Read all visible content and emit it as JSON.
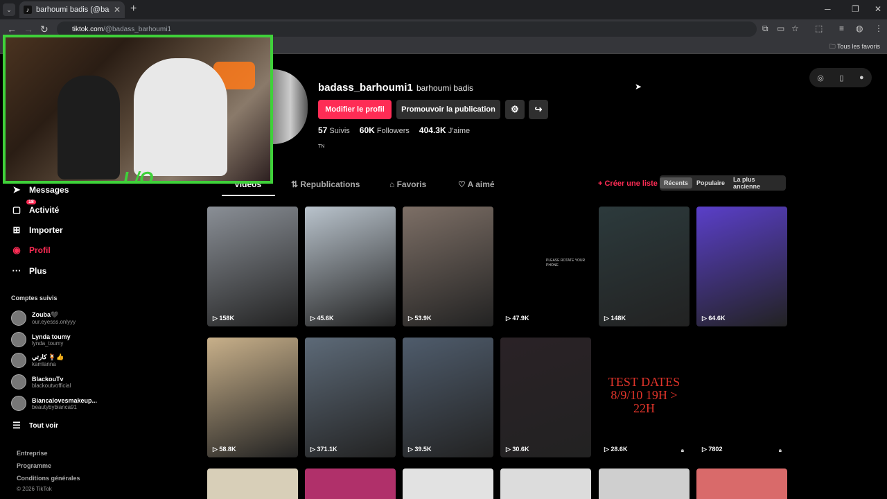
{
  "browser": {
    "tab_title": "barhoumi badis (@badass_barh",
    "url_host": "tiktok.com",
    "url_path": "/@badass_barhoumi1",
    "bookmarks_label": "Tous les favoris"
  },
  "stream_overlay": {
    "logo_text": "L/O"
  },
  "sidebar": {
    "items": [
      {
        "label": "Messages",
        "icon": "send-icon"
      },
      {
        "label": "Activité",
        "icon": "inbox-icon",
        "badge": "18"
      },
      {
        "label": "Importer",
        "icon": "upload-icon"
      },
      {
        "label": "Profil",
        "icon": "profile-avatar-icon"
      },
      {
        "label": "Plus",
        "icon": "more-dots-icon"
      }
    ],
    "following_title": "Comptes suivis",
    "following": [
      {
        "name": "Zouba🖤",
        "handle": "our.eyesss.onlyyy"
      },
      {
        "name": "Lynda toumy",
        "handle": "lynda_toumy"
      },
      {
        "name": "كارتي 🍹👍",
        "handle": "kamlanna"
      },
      {
        "name": "BlackouTv",
        "handle": "blackoutvofficial"
      },
      {
        "name": "Biancalovesmakeup...",
        "handle": "beautybybianca91"
      }
    ],
    "see_all": "Tout voir",
    "footer": [
      "Entreprise",
      "Programme",
      "Conditions générales"
    ],
    "copyright": "© 2026 TikTok"
  },
  "profile": {
    "username": "badass_barhoumi1",
    "display_name": "barhoumi badis",
    "edit_button": "Modifier le profil",
    "promote_button": "Promouvoir la publication",
    "following_count": "57",
    "following_label": "Suivis",
    "followers_count": "60K",
    "followers_label": "Followers",
    "likes_count": "404.3K",
    "likes_label": "J'aime",
    "region": "TN"
  },
  "content_tabs": {
    "videos": "Vidéos",
    "reposts": "Republications",
    "favorites": "Favoris",
    "liked": "A aimé",
    "create_list": "+ Créer une liste de lecture",
    "sort": [
      "Récents",
      "Populaire",
      "La plus ancienne"
    ]
  },
  "videos": [
    {
      "views": "158K",
      "color": "#8a8f96"
    },
    {
      "views": "45.6K",
      "color": "#b9c3cc"
    },
    {
      "views": "53.9K",
      "color": "#7d6f66"
    },
    {
      "views": "47.9K",
      "color": "#000000",
      "overlay": "PLEASE ROTATE YOUR PHONE"
    },
    {
      "views": "148K",
      "color": "#2c3a3c"
    },
    {
      "views": "64.6K",
      "color": "#5a3fc9"
    },
    {
      "views": "58.8K",
      "color": "#c8b08a"
    },
    {
      "views": "371.1K",
      "color": "#5d6a78"
    },
    {
      "views": "39.5K",
      "color": "#4f5c6c"
    },
    {
      "views": "30.6K",
      "color": "#2a2226"
    },
    {
      "views": "28.6K",
      "color": "#000000",
      "overlay": "TEST DATES 8/9/10 19H > 22H",
      "locked": true
    },
    {
      "views": "7802",
      "color": "#000000",
      "locked": true
    }
  ],
  "third_row_colors": [
    "#d8cfb8",
    "#b0306a",
    "#e2e2e2",
    "#dcdcdc",
    "#cfcfcf",
    "#d96a6a"
  ],
  "colors": {
    "accent": "#fe2c55",
    "overlay_border": "#3fd13a"
  }
}
